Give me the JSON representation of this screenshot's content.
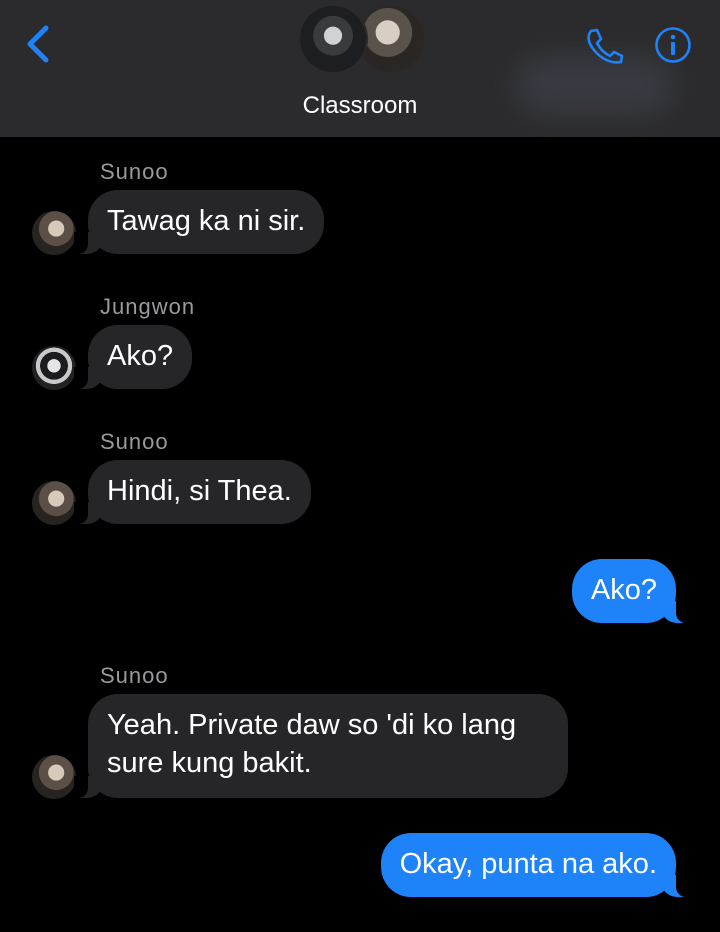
{
  "header": {
    "title": "Classroom",
    "back_icon": "chevron-left-icon",
    "call_icon": "phone-icon",
    "info_icon": "info-icon",
    "accent_color": "#1e82f8"
  },
  "messages": [
    {
      "sender": "Sunoo",
      "text": "Tawag ka ni sir.",
      "direction": "incoming"
    },
    {
      "sender": "Jungwon",
      "text": "Ako?",
      "direction": "incoming"
    },
    {
      "sender": "Sunoo",
      "text": "Hindi, si Thea.",
      "direction": "incoming"
    },
    {
      "text": "Ako?",
      "direction": "outgoing"
    },
    {
      "sender": "Sunoo",
      "text": "Yeah. Private daw so 'di ko lang sure kung bakit.",
      "direction": "incoming"
    },
    {
      "text": "Okay, punta na ako.",
      "direction": "outgoing"
    }
  ],
  "colors": {
    "incoming_bubble": "#262628",
    "outgoing_bubble": "#1e82f8",
    "header_bg": "#2b2b2d"
  }
}
